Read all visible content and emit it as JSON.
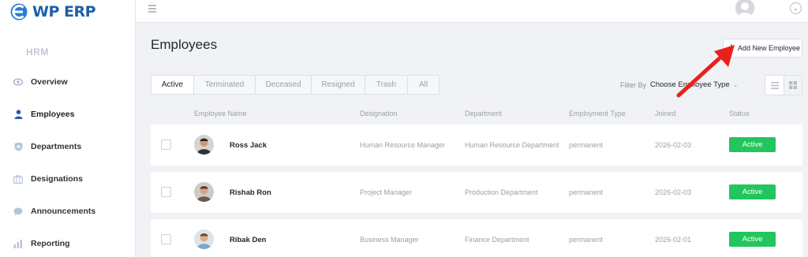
{
  "app": {
    "logo_prefix": "WP",
    "logo_suffix": "ERP",
    "module": "HRM"
  },
  "sidebar": {
    "items": [
      {
        "label": "Overview",
        "icon": "eye-icon"
      },
      {
        "label": "Employees",
        "icon": "user-icon"
      },
      {
        "label": "Departments",
        "icon": "shield-icon"
      },
      {
        "label": "Designations",
        "icon": "briefcase-icon"
      },
      {
        "label": "Announcements",
        "icon": "chat-bubble-icon"
      },
      {
        "label": "Reporting",
        "icon": "bar-chart-icon"
      }
    ],
    "active_index": 1
  },
  "header": {
    "title": "Employees",
    "add_button_plus": "+",
    "add_button_label": "Add New Employee"
  },
  "tabs": [
    "Active",
    "Terminated",
    "Deceased",
    "Resigned",
    "Trash",
    "All"
  ],
  "filter": {
    "label": "Filter By",
    "value": "Choose Employee Type",
    "caret": "⌄"
  },
  "table": {
    "headers": [
      "Employee Name",
      "Designation",
      "Department",
      "Employment Type",
      "Joined",
      "Status"
    ],
    "rows": [
      {
        "name": "Ross Jack",
        "designation": "Human Resource Manager",
        "department": "Human Resource Department",
        "type": "permanent",
        "joined": "2026-02-03",
        "status": "Active"
      },
      {
        "name": "Rishab Ron",
        "designation": "Project Manager",
        "department": "Production Department",
        "type": "permanent",
        "joined": "2026-02-03",
        "status": "Active"
      },
      {
        "name": "Ribak Den",
        "designation": "Business Manager",
        "department": "Finance Department",
        "type": "permanent",
        "joined": "2026-02-01",
        "status": "Active"
      }
    ]
  },
  "colors": {
    "brand": "#1f5fa8",
    "status_active": "#23c55e",
    "annotation_arrow": "#e8211b"
  }
}
